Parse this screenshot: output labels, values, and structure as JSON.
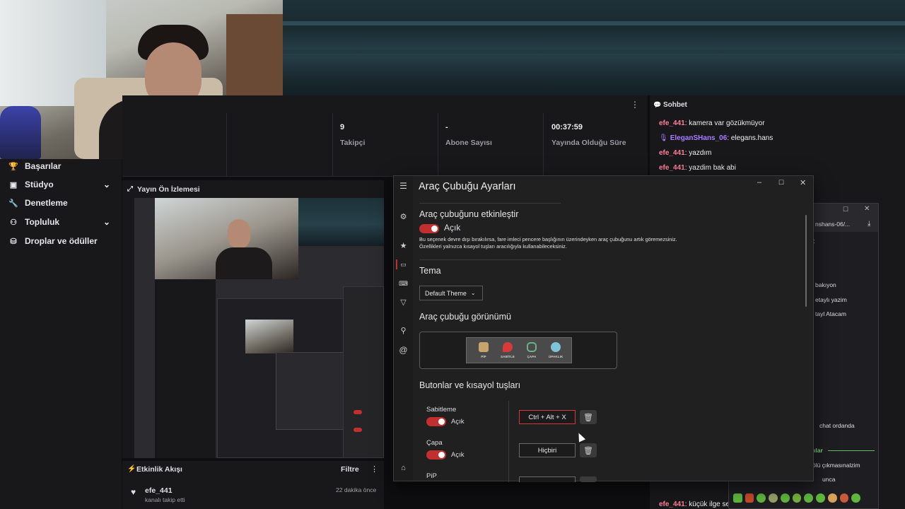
{
  "sidebar": {
    "items": [
      {
        "label": "Başarılar",
        "icon": "trophy-icon"
      },
      {
        "label": "Stüdyo",
        "icon": "studio-icon",
        "expandable": true
      },
      {
        "label": "Denetleme",
        "icon": "wrench-icon"
      },
      {
        "label": "Topluluk",
        "icon": "community-icon",
        "expandable": true
      },
      {
        "label": "Droplar ve ödüller",
        "icon": "drops-icon"
      }
    ]
  },
  "stats": [
    {
      "value": "9",
      "label": "Takipçi"
    },
    {
      "value": "-",
      "label": "Abone Sayısı"
    },
    {
      "value": "00:37:59",
      "label": "Yayında Olduğu Süre"
    }
  ],
  "preview": {
    "title": "Yayın Ön İzlemesi"
  },
  "activity": {
    "title": "Etkinlik Akışı",
    "filter_label": "Filtre",
    "events": [
      {
        "user": "efe_441",
        "text": "kanalı takip etti",
        "time": "22 dakika önce"
      }
    ]
  },
  "chat": {
    "title": "Sohbet",
    "messages": [
      {
        "user": "efe_441",
        "user_color": "#ff7f9a",
        "text": "kamera var gözükmüyor"
      },
      {
        "user": "EleganSHans_06",
        "user_color": "#a97cff",
        "text": "elegans.hans",
        "badge": "mic"
      },
      {
        "user": "efe_441",
        "user_color": "#ff7f9a",
        "text": "yazdım"
      },
      {
        "user": "efe_441",
        "user_color": "#ff7f9a",
        "text": "yazdim bak abi"
      }
    ],
    "last_message": {
      "user": "efe_441",
      "text": "küçük ilge ser"
    }
  },
  "second_window": {
    "url_fragment": "nshans-06/...",
    "fragments": [
      "t",
      "bakıyon",
      "etaylı yazim",
      "tayl Atacam",
      "chat ordanda",
      "ılar",
      "ölü çıkmasınalzim",
      "unca"
    ]
  },
  "settings": {
    "title": "Araç Çubuğu Ayarları",
    "enable": {
      "heading": "Araç çubuğunu etkinleştir",
      "state": "Açık",
      "description_line1": "Bu seçenek devre dışı bırakılırsa, fare imleci pencere başlığının üzerindeyken araç çubuğunu artık göremezsiniz.",
      "description_line2": "Özellikleri yalnızca kısayol tuşları aracılığıyla kullanabileceksiniz."
    },
    "theme": {
      "heading": "Tema",
      "selected": "Default Theme"
    },
    "appearance": {
      "heading": "Araç çubuğu görünümü",
      "buttons": [
        {
          "label": "PİP",
          "icon": "pip-icon",
          "color": "#c9a46a"
        },
        {
          "label": "SABİTLE",
          "icon": "pin-icon",
          "color": "#d83a3a"
        },
        {
          "label": "ÇAPA",
          "icon": "chain-icon",
          "color": "#69b38a"
        },
        {
          "label": "OPAKLIK",
          "icon": "opacity-icon",
          "color": "#7ec3d8"
        }
      ]
    },
    "shortcuts": {
      "heading": "Butonlar ve kısayol tuşları",
      "rows": [
        {
          "name": "Sabitleme",
          "state": "Açık",
          "hotkey": "Ctrl + Alt + X",
          "active": true
        },
        {
          "name": "Çapa",
          "state": "Açık",
          "hotkey": "Hiçbiri",
          "active": false
        },
        {
          "name": "PiP",
          "state": "",
          "hotkey": "",
          "active": false
        }
      ]
    }
  },
  "colors": {
    "accent": "#c22f2f",
    "background": "#0e0e10",
    "panel": "#18181b"
  }
}
